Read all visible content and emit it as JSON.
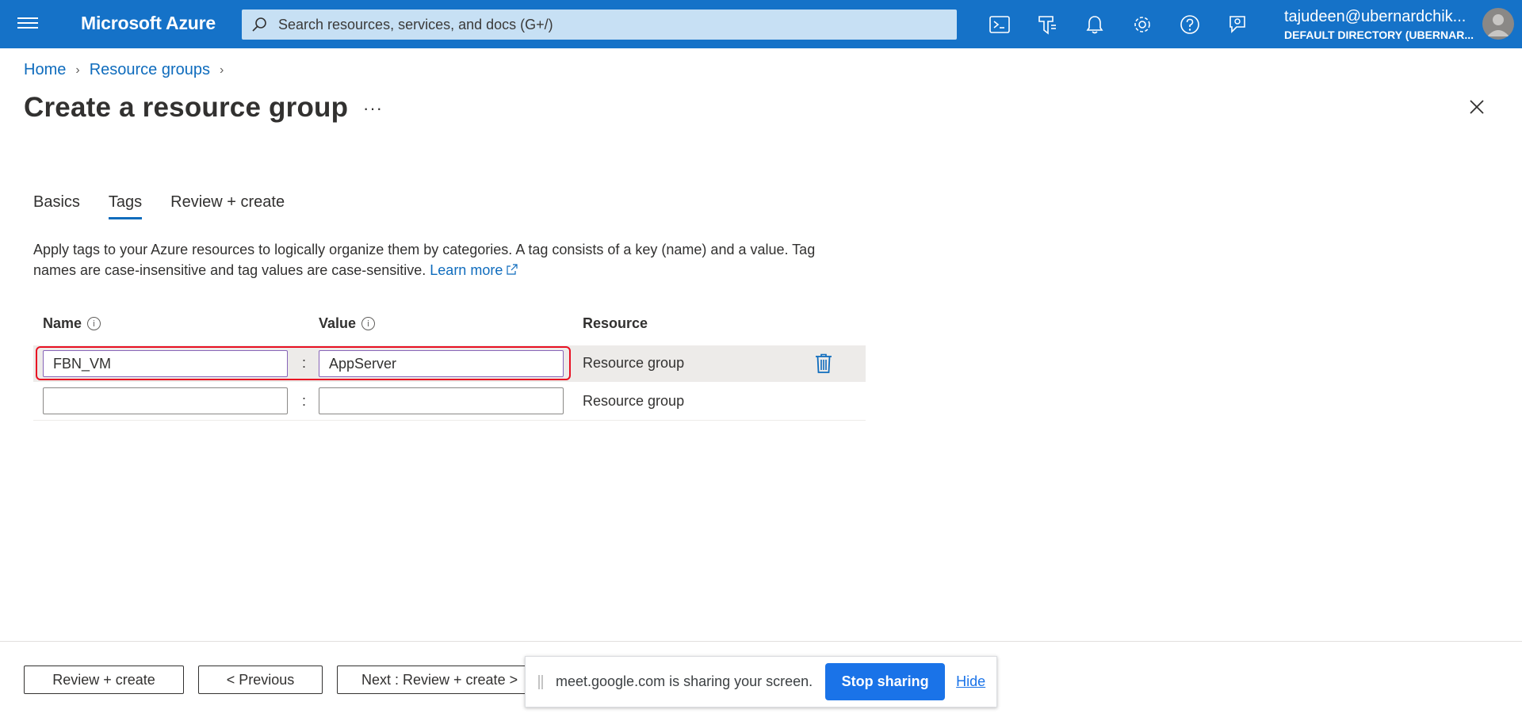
{
  "topbar": {
    "brand": "Microsoft Azure",
    "search_placeholder": "Search resources, services, and docs (G+/)",
    "user_email": "tajudeen@ubernardchik...",
    "user_directory": "DEFAULT DIRECTORY (UBERNAR...",
    "icons": [
      "menu-icon",
      "cloud-shell-icon",
      "directory-filter-icon",
      "notifications-icon",
      "settings-icon",
      "help-icon",
      "feedback-icon"
    ]
  },
  "breadcrumb": {
    "items": [
      "Home",
      "Resource groups"
    ]
  },
  "page": {
    "title": "Create a resource group",
    "more": "···"
  },
  "tabs": [
    "Basics",
    "Tags",
    "Review + create"
  ],
  "active_tab": "Tags",
  "description": {
    "line": "Apply tags to your Azure resources to logically organize them by categories. A tag consists of a key (name) and a value. Tag names are case-insensitive and tag values are case-sensitive.",
    "link": "Learn more"
  },
  "table": {
    "headers": {
      "name": "Name",
      "value": "Value",
      "resource": "Resource"
    },
    "separator": ":",
    "rows": [
      {
        "name": "FBN_VM",
        "value": "AppServer",
        "resource": "Resource group"
      },
      {
        "name": "",
        "value": "",
        "resource": "Resource group"
      }
    ]
  },
  "footer": {
    "review_create": "Review + create",
    "previous": "< Previous",
    "next": "Next : Review + create >"
  },
  "share_bar": {
    "message": "meet.google.com is sharing your screen.",
    "stop": "Stop sharing",
    "hide": "Hide"
  },
  "colors": {
    "topbar": "#1572c8",
    "link": "#0f6cbd",
    "highlight_border": "#e81123",
    "stop_button": "#1a73e8"
  }
}
